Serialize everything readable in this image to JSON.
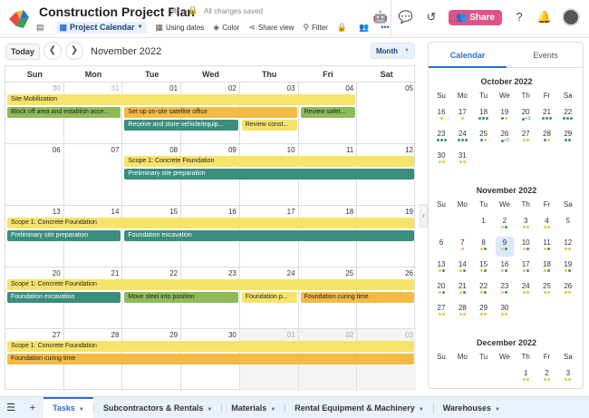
{
  "header": {
    "title": "Construction Project Plan",
    "saved_status": "All changes saved",
    "toolbar": {
      "view_name": "Project Calendar",
      "using_dates": "Using dates",
      "color": "Color",
      "share_view": "Share view",
      "filter": "Filter"
    },
    "share_label": "Share"
  },
  "calendar": {
    "today_label": "Today",
    "month_title": "November 2022",
    "view_mode": "Month",
    "weekdays": [
      "Sun",
      "Mon",
      "Tue",
      "Wed",
      "Thu",
      "Fri",
      "Sat"
    ],
    "weeks": [
      {
        "days": [
          "30",
          "31",
          "01",
          "02",
          "03",
          "04",
          "05"
        ],
        "muted": [
          true,
          true,
          false,
          false,
          false,
          false,
          false
        ],
        "events": [
          {
            "label": "Site Mobilization",
            "color": "yellow",
            "start": 0,
            "span": 6,
            "row": 0
          },
          {
            "label": "Block off area and establish acce...",
            "color": "green",
            "start": 0,
            "span": 2,
            "row": 1
          },
          {
            "label": "Set up on-site satellite office",
            "color": "orange",
            "start": 2,
            "span": 3,
            "row": 1
          },
          {
            "label": "Review safet...",
            "color": "green",
            "start": 5,
            "span": 1,
            "row": 1
          },
          {
            "label": "Receive and store vehicle/equip...",
            "color": "teal",
            "start": 2,
            "span": 2,
            "row": 2
          },
          {
            "label": "Review const...",
            "color": "yellow",
            "start": 4,
            "span": 1,
            "row": 2
          }
        ]
      },
      {
        "days": [
          "06",
          "07",
          "08",
          "09",
          "10",
          "11",
          "12"
        ],
        "muted": [
          false,
          false,
          false,
          false,
          false,
          false,
          false
        ],
        "events": [
          {
            "label": "Scope 1: Concrete Foundation",
            "color": "yellow",
            "start": 2,
            "span": 5,
            "row": 0
          },
          {
            "label": "Preliminary site preparation",
            "color": "teal",
            "start": 2,
            "span": 5,
            "row": 1
          }
        ]
      },
      {
        "days": [
          "13",
          "14",
          "15",
          "16",
          "17",
          "18",
          "19"
        ],
        "muted": [
          false,
          false,
          false,
          false,
          false,
          false,
          false
        ],
        "events": [
          {
            "label": "Scope 1: Concrete Foundation",
            "color": "yellow",
            "start": 0,
            "span": 7,
            "row": 0
          },
          {
            "label": "Preliminary site preparation",
            "color": "teal",
            "start": 0,
            "span": 2,
            "row": 1
          },
          {
            "label": "Foundation excavation",
            "color": "teal",
            "start": 2,
            "span": 5,
            "row": 1
          }
        ]
      },
      {
        "days": [
          "20",
          "21",
          "22",
          "23",
          "24",
          "25",
          "26"
        ],
        "muted": [
          false,
          false,
          false,
          false,
          false,
          false,
          false
        ],
        "events": [
          {
            "label": "Scope 1: Concrete Foundation",
            "color": "yellow",
            "start": 0,
            "span": 7,
            "row": 0
          },
          {
            "label": "Foundation excavation",
            "color": "teal",
            "start": 0,
            "span": 2,
            "row": 1
          },
          {
            "label": "Move steel into position",
            "color": "green",
            "start": 2,
            "span": 2,
            "row": 1
          },
          {
            "label": "Foundation p...",
            "color": "yellow",
            "start": 4,
            "span": 1,
            "row": 1
          },
          {
            "label": "Foundation curing time",
            "color": "orange",
            "start": 5,
            "span": 2,
            "row": 1
          }
        ]
      },
      {
        "days": [
          "27",
          "28",
          "29",
          "30",
          "01",
          "02",
          "03"
        ],
        "muted": [
          false,
          false,
          false,
          false,
          true,
          true,
          true
        ],
        "events": [
          {
            "label": "Scope 1: Concrete Foundation",
            "color": "yellow",
            "start": 0,
            "span": 7,
            "row": 0
          },
          {
            "label": "Foundation curing time",
            "color": "orange",
            "start": 0,
            "span": 7,
            "row": 1
          }
        ]
      }
    ]
  },
  "panel": {
    "tabs": [
      "Calendar",
      "Events"
    ],
    "weekdays": [
      "Su",
      "Mo",
      "Tu",
      "We",
      "Th",
      "Fr",
      "Sa"
    ],
    "months": [
      {
        "title": "October 2022",
        "weeks": [
          [
            {
              "d": "16",
              "dots": "o"
            },
            {
              "d": "17",
              "dots": "o"
            },
            {
              "d": "18",
              "dots": "ggg"
            },
            {
              "d": "19",
              "dots": "go"
            },
            {
              "d": "20",
              "dots": "g+3"
            },
            {
              "d": "21",
              "dots": "ggg"
            },
            {
              "d": "22",
              "dots": "ggg"
            }
          ],
          [
            {
              "d": "23",
              "dots": "ggg"
            },
            {
              "d": "24",
              "dots": "ggg"
            },
            {
              "d": "25",
              "dots": "go"
            },
            {
              "d": "26",
              "dots": "g+3"
            },
            {
              "d": "27",
              "dots": "yo"
            },
            {
              "d": "28",
              "dots": "go"
            },
            {
              "d": "29",
              "dots": "gg"
            }
          ],
          [
            {
              "d": "30",
              "dots": "yo"
            },
            {
              "d": "31",
              "dots": "yo"
            },
            {
              "d": "",
              "dots": ""
            },
            {
              "d": "",
              "dots": ""
            },
            {
              "d": "",
              "dots": ""
            },
            {
              "d": "",
              "dots": ""
            },
            {
              "d": "",
              "dots": ""
            }
          ]
        ]
      },
      {
        "title": "November 2022",
        "weeks": [
          [
            {
              "d": "",
              "dots": ""
            },
            {
              "d": "",
              "dots": ""
            },
            {
              "d": "1",
              "dots": ""
            },
            {
              "d": "2",
              "dots": "yg"
            },
            {
              "d": "3",
              "dots": "yo"
            },
            {
              "d": "4",
              "dots": "yo"
            },
            {
              "d": "5",
              "dots": ""
            }
          ],
          [
            {
              "d": "6",
              "dots": ""
            },
            {
              "d": "7",
              "dots": "o"
            },
            {
              "d": "8",
              "dots": "yg"
            },
            {
              "d": "9",
              "dots": "yg",
              "sel": true
            },
            {
              "d": "10",
              "dots": "yg"
            },
            {
              "d": "11",
              "dots": "yg"
            },
            {
              "d": "12",
              "dots": "yo"
            }
          ],
          [
            {
              "d": "13",
              "dots": "yg"
            },
            {
              "d": "14",
              "dots": "yg"
            },
            {
              "d": "15",
              "dots": "yg"
            },
            {
              "d": "16",
              "dots": "yg"
            },
            {
              "d": "17",
              "dots": "yg"
            },
            {
              "d": "18",
              "dots": "yg"
            },
            {
              "d": "19",
              "dots": "yg"
            }
          ],
          [
            {
              "d": "20",
              "dots": "yg"
            },
            {
              "d": "21",
              "dots": "yg"
            },
            {
              "d": "22",
              "dots": "yg"
            },
            {
              "d": "23",
              "dots": "yg"
            },
            {
              "d": "24",
              "dots": "yo"
            },
            {
              "d": "25",
              "dots": "yo"
            },
            {
              "d": "26",
              "dots": "yo"
            }
          ],
          [
            {
              "d": "27",
              "dots": "yo"
            },
            {
              "d": "28",
              "dots": "yo"
            },
            {
              "d": "29",
              "dots": "yo"
            },
            {
              "d": "30",
              "dots": "yo"
            },
            {
              "d": "",
              "dots": ""
            },
            {
              "d": "",
              "dots": ""
            },
            {
              "d": "",
              "dots": ""
            }
          ]
        ]
      },
      {
        "title": "December 2022",
        "weeks": [
          [
            {
              "d": "",
              "dots": ""
            },
            {
              "d": "",
              "dots": ""
            },
            {
              "d": "",
              "dots": ""
            },
            {
              "d": "",
              "dots": ""
            },
            {
              "d": "1",
              "dots": "yo"
            },
            {
              "d": "2",
              "dots": "yo"
            },
            {
              "d": "3",
              "dots": "yo"
            }
          ]
        ]
      }
    ]
  },
  "sheets": {
    "tabs": [
      "Tasks",
      "Subcontractors & Rentals",
      "Materials",
      "Rental Equipment & Machinery",
      "Warehouses"
    ],
    "active": 0
  },
  "colors": {
    "yellow": "#f7e36a",
    "green": "#8dbb59",
    "teal": "#3a8e7d",
    "orange": "#f3bb45",
    "accent": "#2a6fd6",
    "share": "#e0528a"
  },
  "icons": {
    "logo": "app-logo-icon",
    "sidebar": "sidebar-toggle-icon",
    "view": "calendar-view-icon",
    "dates": "calendar-icon",
    "color": "paint-icon",
    "share_view": "share-icon",
    "filter": "filter-icon",
    "bot": "bot-icon",
    "comment": "comment-icon",
    "history": "history-icon",
    "help": "help-icon",
    "bell": "bell-icon"
  }
}
